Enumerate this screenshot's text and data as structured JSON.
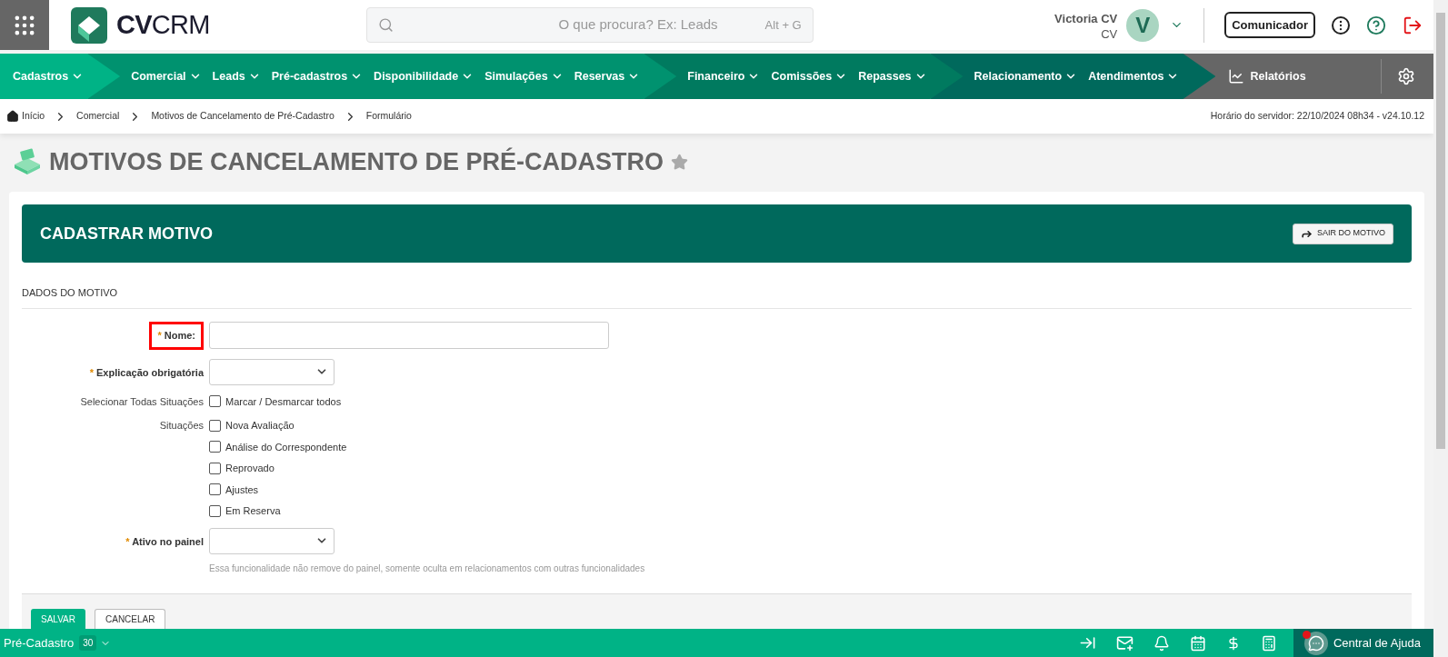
{
  "header": {
    "logo": {
      "strong": "CV",
      "light": "CRM"
    },
    "search": {
      "placeholder": "O que procura? Ex: Leads",
      "shortcut": "Alt + G"
    },
    "user": {
      "name": "Victoria CV",
      "role": "CV",
      "initial": "V"
    },
    "communicator_button": "Comunicador"
  },
  "nav": [
    {
      "color": "#00b386",
      "kind": "menu",
      "items": [
        "Cadastros"
      ]
    },
    {
      "color": "#00926f",
      "kind": "menu",
      "items": [
        "Comercial",
        "Leads",
        "Pré-cadastros",
        "Disponibilidade",
        "Simulações",
        "Reservas"
      ]
    },
    {
      "color": "#007a5f",
      "kind": "menu",
      "items": [
        "Financeiro",
        "Comissões",
        "Repasses"
      ]
    },
    {
      "color": "#00695c",
      "kind": "menu",
      "items": [
        "Relacionamento",
        "Atendimentos"
      ]
    },
    {
      "color": "#666666",
      "kind": "report",
      "items": [
        "Relatórios"
      ]
    }
  ],
  "breadcrumb": {
    "items": [
      "Início",
      "Comercial",
      "Motivos de Cancelamento de Pré-Cadastro",
      "Formulário"
    ],
    "server_time": "Horário do servidor: 22/10/2024 08h34 - v24.10.12"
  },
  "page_title": "MOTIVOS DE CANCELAMENTO DE PRÉ-CADASTRO",
  "form": {
    "title": "CADASTRAR MOTIVO",
    "exit_button": "SAIR DO MOTIVO",
    "section": "DADOS DO MOTIVO",
    "fields": [
      {
        "kind": "text",
        "marker": "*",
        "label": "Nome:",
        "bold": true,
        "highlighted": true
      },
      {
        "kind": "select",
        "marker": "*",
        "label": "Explicação obrigatória",
        "bold": true,
        "highlighted": false
      },
      {
        "kind": "checkboxes",
        "label": "Selecionar Todas Situações",
        "bold": false,
        "highlighted": false,
        "options": [
          {
            "label": "Marcar / Desmarcar todos",
            "checked": false
          }
        ]
      },
      {
        "kind": "checkboxes",
        "label": "Situações",
        "bold": false,
        "highlighted": false,
        "options": [
          {
            "label": "Nova Avaliação",
            "checked": false
          },
          {
            "label": "Análise do Correspondente",
            "checked": false
          },
          {
            "label": "Reprovado",
            "checked": false
          },
          {
            "label": "Ajustes",
            "checked": false
          },
          {
            "label": "Em Reserva",
            "checked": false
          }
        ]
      },
      {
        "kind": "select",
        "marker": "*",
        "label": "Ativo no painel",
        "bold": true,
        "highlighted": false,
        "hint": "Essa funcionalidade não remove do painel, somente oculta em relacionamentos com outras funcionalidades"
      }
    ],
    "buttons": [
      {
        "label": "SALVAR",
        "kind": "primary"
      },
      {
        "label": "CANCELAR",
        "kind": "secondary"
      }
    ]
  },
  "bottom_bar": {
    "module": "Pré-Cadastro",
    "count": "30",
    "help": "Central de Ajuda",
    "notification": true
  }
}
